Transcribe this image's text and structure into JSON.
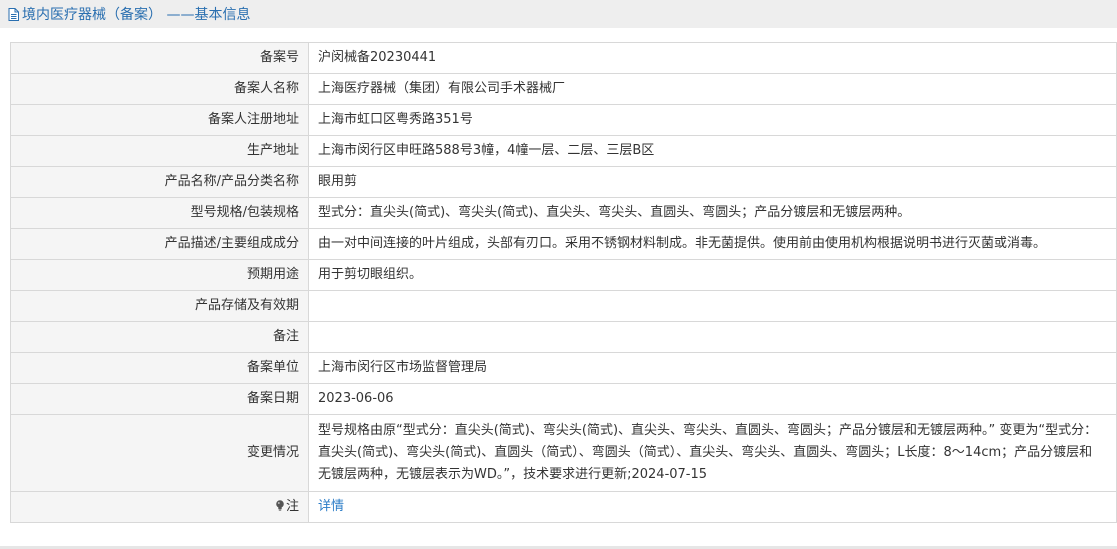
{
  "header": {
    "title": "境内医疗器械（备案） ——基本信息",
    "icon": "document-icon",
    "accent_color": "#2a6fb0"
  },
  "rows": [
    {
      "label": "备案号",
      "value": "沪闵械备20230441"
    },
    {
      "label": "备案人名称",
      "value": "上海医疗器械（集团）有限公司手术器械厂"
    },
    {
      "label": "备案人注册地址",
      "value": "上海市虹口区粤秀路351号"
    },
    {
      "label": "生产地址",
      "value": "上海市闵行区申旺路588号3幢，4幢一层、二层、三层B区"
    },
    {
      "label": "产品名称/产品分类名称",
      "value": "眼用剪"
    },
    {
      "label": "型号规格/包装规格",
      "value": "型式分：直尖头(简式)、弯尖头(简式)、直尖头、弯尖头、直圆头、弯圆头；产品分镀层和无镀层两种。"
    },
    {
      "label": "产品描述/主要组成成分",
      "value": "由一对中间连接的叶片组成，头部有刃口。采用不锈钢材料制成。非无菌提供。使用前由使用机构根据说明书进行灭菌或消毒。"
    },
    {
      "label": "预期用途",
      "value": "用于剪切眼组织。"
    },
    {
      "label": "产品存储及有效期",
      "value": ""
    },
    {
      "label": "备注",
      "value": ""
    },
    {
      "label": "备案单位",
      "value": "上海市闵行区市场监督管理局"
    },
    {
      "label": "备案日期",
      "value": "2023-06-06"
    },
    {
      "label": "变更情况",
      "value": "型号规格由原“型式分：直尖头(简式)、弯尖头(简式)、直尖头、弯尖头、直圆头、弯圆头；产品分镀层和无镀层两种。” 变更为“型式分：直尖头(简式)、弯尖头(简式)、直圆头（简式）、弯圆头（简式）、直尖头、弯尖头、直圆头、弯圆头；L长度：8～14cm；产品分镀层和无镀层两种，无镀层表示为WD。”，技术要求进行更新;2024-07-15"
    }
  ],
  "note": {
    "label": "注",
    "icon": "bulb-icon",
    "link_text": "详情",
    "link_color": "#2a7cc7"
  }
}
